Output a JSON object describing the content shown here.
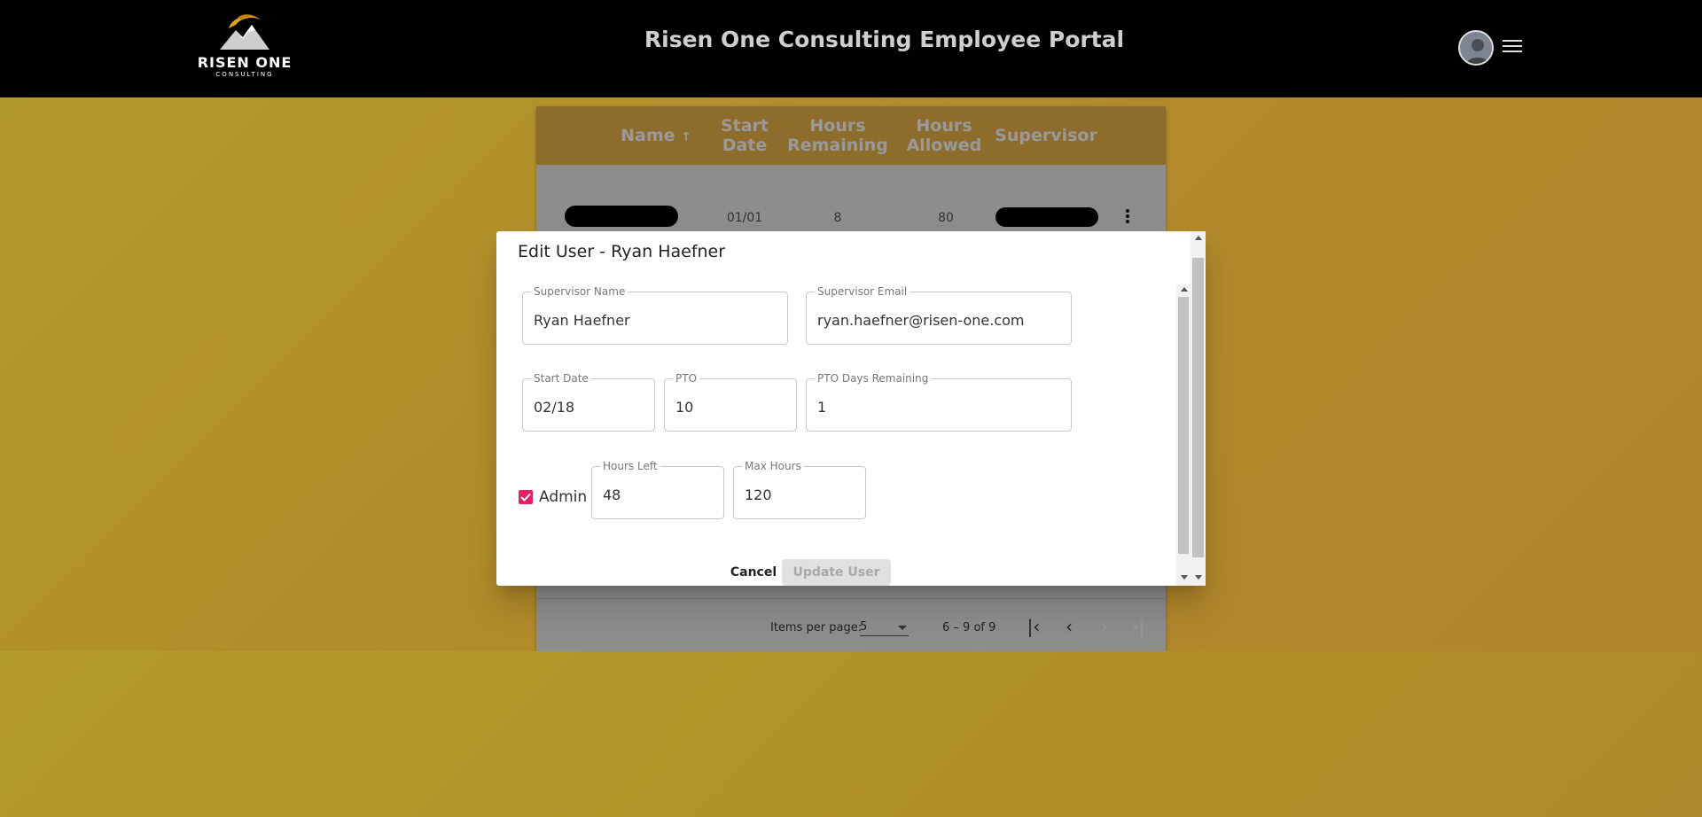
{
  "header": {
    "logo_text": "RISEN ONE",
    "logo_sub": "CONSULTING",
    "title": "Risen One Consulting Employee Portal",
    "avatar_icon": "user-avatar",
    "menu_icon": "hamburger-menu-icon"
  },
  "table": {
    "headers": {
      "name": "Name",
      "start_date": "Start Date",
      "hours_remaining": "Hours Remaining",
      "hours_allowed": "Hours Allowed",
      "supervisor": "Supervisor"
    },
    "sort_indicator": "↑",
    "rows": [
      {
        "start_date": "01/01",
        "hours_remaining": "8",
        "hours_allowed": "80"
      }
    ]
  },
  "paginator": {
    "items_per_page_label": "Items per page:",
    "items_per_page_value": "5",
    "range_label": "6 – 9 of 9"
  },
  "dialog": {
    "title": "Edit User - Ryan Haefner",
    "fields": {
      "supervisor_name": {
        "label": "Supervisor Name",
        "value": "Ryan Haefner"
      },
      "supervisor_email": {
        "label": "Supervisor Email",
        "value": "ryan.haefner@risen-one.com"
      },
      "start_date": {
        "label": "Start Date",
        "value": "02/18"
      },
      "pto": {
        "label": "PTO",
        "value": "10"
      },
      "pto_days_remaining": {
        "label": "PTO Days Remaining",
        "value": "1"
      },
      "hours_left": {
        "label": "Hours Left",
        "value": "48"
      },
      "max_hours": {
        "label": "Max Hours",
        "value": "120"
      }
    },
    "admin": {
      "label": "Admin",
      "checked": true
    },
    "cancel_label": "Cancel",
    "update_label": "Update User"
  },
  "colors": {
    "header_bg": "#000000",
    "page_bg": "#b3992b",
    "checkbox_accent": "#e91e63",
    "title_color": "#cfcfcf"
  }
}
